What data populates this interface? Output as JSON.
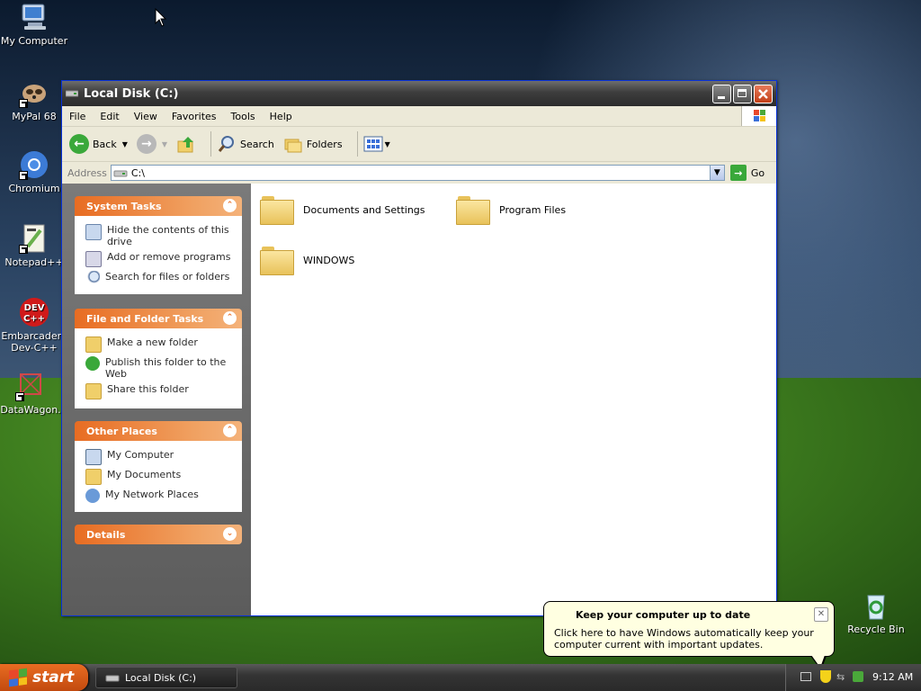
{
  "desktop": {
    "icons": [
      {
        "label": "My Computer"
      },
      {
        "label": "MyPal 68"
      },
      {
        "label": "Chromium"
      },
      {
        "label": "Notepad++"
      },
      {
        "label": "Embarcadero Dev-C++"
      },
      {
        "label": "DataWagon."
      },
      {
        "label": "Recycle Bin"
      }
    ]
  },
  "window": {
    "title": "Local Disk (C:)",
    "menu": [
      "File",
      "Edit",
      "View",
      "Favorites",
      "Tools",
      "Help"
    ],
    "toolbar": {
      "back": "Back",
      "search": "Search",
      "folders": "Folders"
    },
    "address": {
      "label": "Address",
      "value": "C:\\",
      "go": "Go"
    },
    "tasks": {
      "system": {
        "title": "System Tasks",
        "items": [
          "Hide the contents of this drive",
          "Add or remove programs",
          "Search for files or folders"
        ]
      },
      "file_folder": {
        "title": "File and Folder Tasks",
        "items": [
          "Make a new folder",
          "Publish this folder to the Web",
          "Share this folder"
        ]
      },
      "other_places": {
        "title": "Other Places",
        "items": [
          "My Computer",
          "My Documents",
          "My Network Places"
        ]
      },
      "details": {
        "title": "Details"
      }
    },
    "folders": [
      "Documents and Settings",
      "Program Files",
      "WINDOWS"
    ]
  },
  "taskbar": {
    "start": "start",
    "task_item": "Local Disk (C:)",
    "clock": "9:12 AM"
  },
  "balloon": {
    "title": "Keep your computer up to date",
    "text": "Click here to have Windows automatically keep your computer current with important updates."
  },
  "colors": {
    "task_header": "#e86c22",
    "titlebar": "#3d3d3d",
    "balloon_bg": "#ffffe1"
  }
}
